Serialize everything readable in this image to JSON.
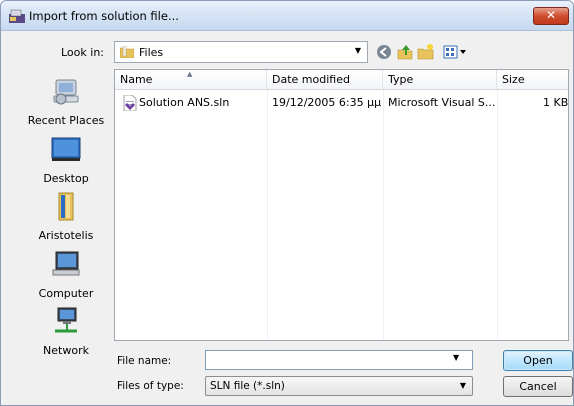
{
  "window": {
    "title": "Import from solution file...",
    "close_label": "✕"
  },
  "lookin": {
    "label": "Look in:",
    "value": "Files"
  },
  "toolbar": {
    "icons": [
      "back-icon",
      "up-folder-icon",
      "new-folder-icon",
      "views-menu-icon"
    ]
  },
  "places": [
    {
      "label": "Recent Places",
      "icon": "recent-places-icon"
    },
    {
      "label": "Desktop",
      "icon": "desktop-icon"
    },
    {
      "label": "Aristotelis",
      "icon": "user-folder-icon"
    },
    {
      "label": "Computer",
      "icon": "computer-icon"
    },
    {
      "label": "Network",
      "icon": "network-icon"
    }
  ],
  "filelist": {
    "columns": [
      "Name",
      "Date modified",
      "Type",
      "Size"
    ],
    "rows": [
      {
        "name": "Solution ANS.sln",
        "date": "19/12/2005 6:35 μμ",
        "type": "Microsoft Visual S...",
        "size": "1 KB"
      }
    ]
  },
  "filename": {
    "label": "File name:",
    "value": ""
  },
  "filetype": {
    "label": "Files of type:",
    "value": "SLN file (*.sln)"
  },
  "buttons": {
    "open": "Open",
    "cancel": "Cancel"
  },
  "colors": {
    "title_gradient": "#d6e4f5",
    "close": "#c13a1c",
    "open_border": "#3c7fb1"
  }
}
